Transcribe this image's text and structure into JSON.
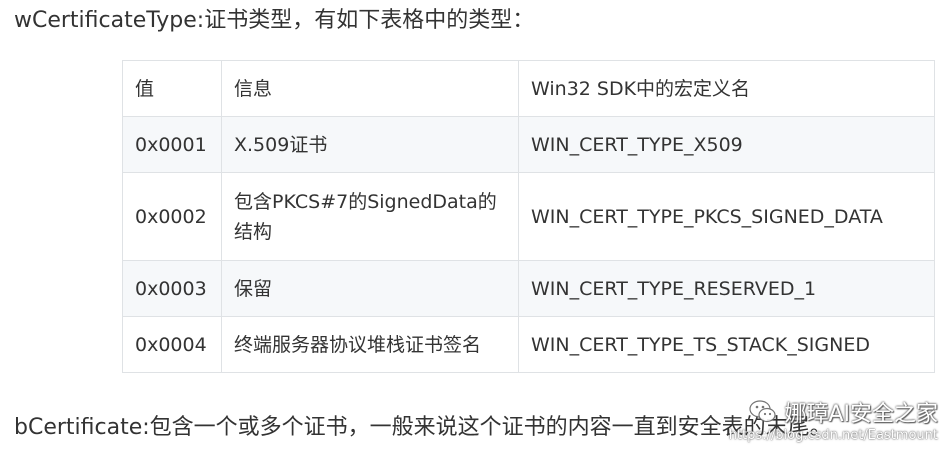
{
  "heading": "wCertificateType:证书类型，有如下表格中的类型：",
  "table": {
    "headers": [
      "值",
      "信息",
      "Win32 SDK中的宏定义名"
    ],
    "rows": [
      {
        "value": "0x0001",
        "info": "X.509证书",
        "macro": "WIN_CERT_TYPE_X509"
      },
      {
        "value": "0x0002",
        "info": "包含PKCS#7的SignedData的结构",
        "macro": "WIN_CERT_TYPE_PKCS_SIGNED_DATA"
      },
      {
        "value": "0x0003",
        "info": "保留",
        "macro": "WIN_CERT_TYPE_RESERVED_1"
      },
      {
        "value": "0x0004",
        "info": "终端服务器协议堆栈证书签名",
        "macro": "WIN_CERT_TYPE_TS_STACK_SIGNED"
      }
    ]
  },
  "footer_text": "bCertificate:包含一个或多个证书，一般来说这个证书的内容一直到安全表的末尾。",
  "watermark": {
    "icon": "wechat-icon",
    "label": "娜璋AI安全之家",
    "url": "https://blog.csdn.net/Eastmount"
  }
}
